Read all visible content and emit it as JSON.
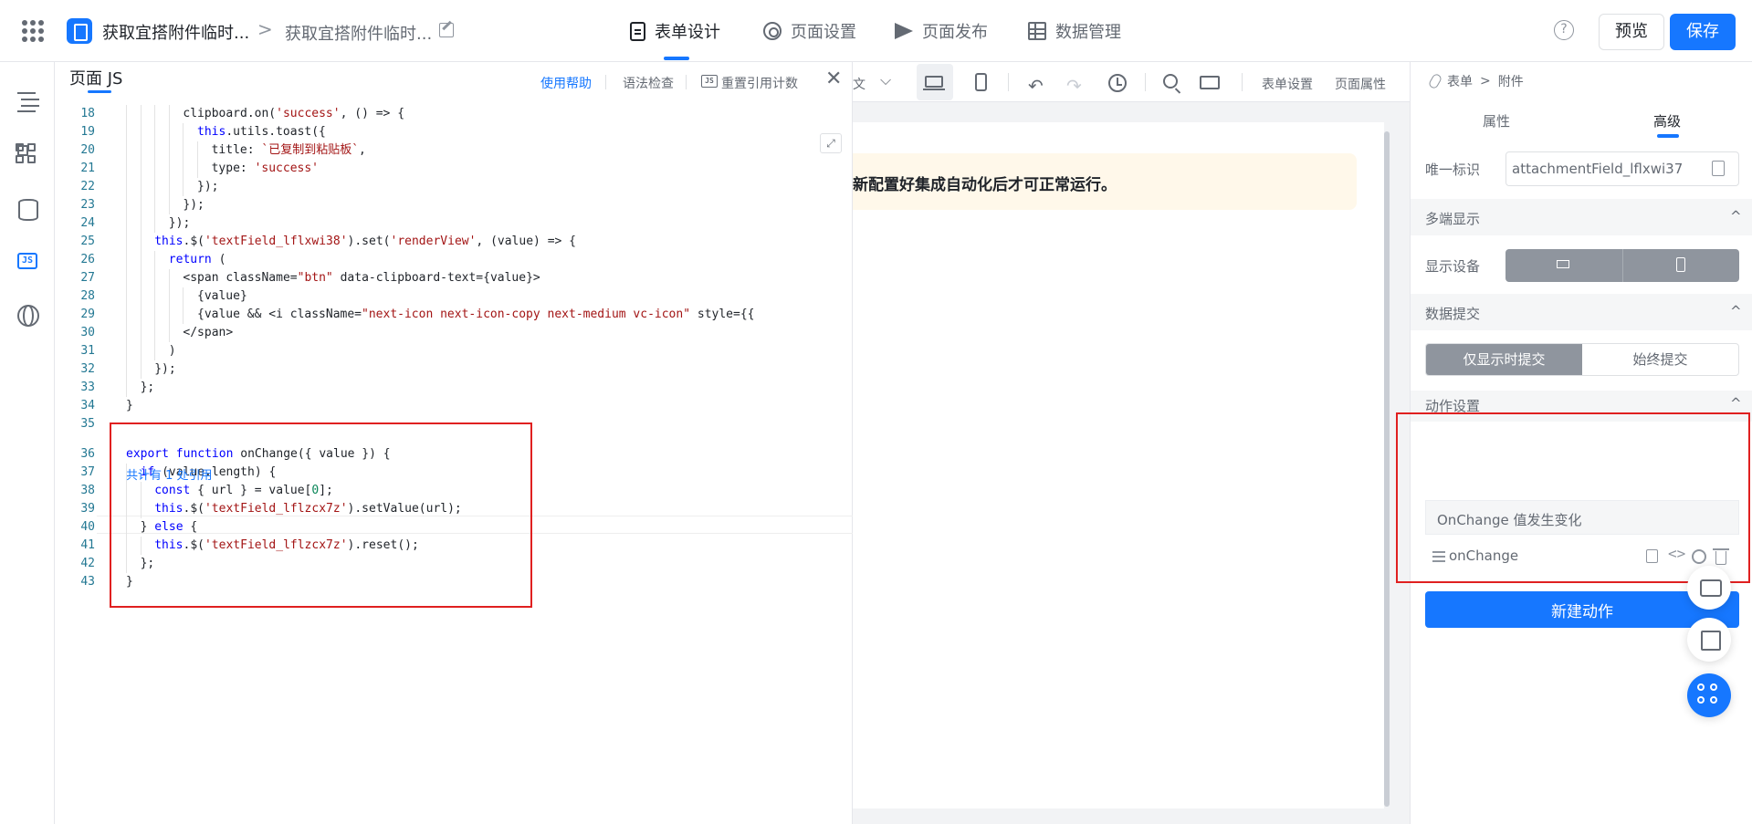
{
  "header": {
    "app_title": "获取宜搭附件临时...",
    "page_title": "获取宜搭附件临时...",
    "crumb_sep": ">",
    "tabs": [
      {
        "label": "表单设计",
        "icon": "form-doc-icon"
      },
      {
        "label": "页面设置",
        "icon": "gear-icon"
      },
      {
        "label": "页面发布",
        "icon": "send-icon"
      },
      {
        "label": "数据管理",
        "icon": "table-icon"
      }
    ],
    "help": "?",
    "preview": "预览",
    "save": "保存"
  },
  "left_rail": [
    "outline-icon",
    "components-icon",
    "datasource-icon",
    "js-icon",
    "globe-icon"
  ],
  "js_panel": {
    "title": "页面 JS",
    "help_link": "使用帮助",
    "lint": "语法检查",
    "reset_refs": "重置引用计数",
    "reset_icon_text": "JS",
    "close": "✕",
    "expand": "⤢",
    "ref_hint": "共计有 1 处引用",
    "lines": [
      {
        "n": "18",
        "indent": 4,
        "parts": [
          [
            "",
            "clipboard.on("
          ],
          [
            "s",
            "'success'"
          ],
          [
            "",
            ", () => {"
          ]
        ]
      },
      {
        "n": "19",
        "indent": 5,
        "parts": [
          [
            "k",
            "this"
          ],
          [
            "",
            ".utils.toast({"
          ]
        ]
      },
      {
        "n": "20",
        "indent": 6,
        "parts": [
          [
            "",
            "title: "
          ],
          [
            "s",
            "`已复制到粘贴板`"
          ],
          [
            "",
            ","
          ]
        ]
      },
      {
        "n": "21",
        "indent": 6,
        "parts": [
          [
            "",
            "type: "
          ],
          [
            "s",
            "'success'"
          ]
        ]
      },
      {
        "n": "22",
        "indent": 5,
        "parts": [
          [
            "",
            "});"
          ]
        ]
      },
      {
        "n": "23",
        "indent": 4,
        "parts": [
          [
            "",
            "});"
          ]
        ]
      },
      {
        "n": "24",
        "indent": 3,
        "parts": [
          [
            "",
            "});"
          ]
        ]
      },
      {
        "n": "25",
        "indent": 2,
        "parts": [
          [
            "k",
            "this"
          ],
          [
            "",
            ".$("
          ],
          [
            "s",
            "'textField_lflxwi38'"
          ],
          [
            "",
            ").set("
          ],
          [
            "s",
            "'renderView'"
          ],
          [
            "",
            ", (value) => {"
          ]
        ]
      },
      {
        "n": "26",
        "indent": 3,
        "parts": [
          [
            "k",
            "return"
          ],
          [
            "",
            " ("
          ]
        ]
      },
      {
        "n": "27",
        "indent": 4,
        "parts": [
          [
            "",
            "<span className="
          ],
          [
            "s",
            "\"btn\""
          ],
          [
            "",
            " data-clipboard-text={value}>"
          ]
        ]
      },
      {
        "n": "28",
        "indent": 5,
        "parts": [
          [
            "",
            "{value}"
          ]
        ]
      },
      {
        "n": "29",
        "indent": 5,
        "parts": [
          [
            "",
            "{value && <i className="
          ],
          [
            "s",
            "\"next-icon next-icon-copy next-medium vc-icon\""
          ],
          [
            "",
            " style={{"
          ]
        ]
      },
      {
        "n": "30",
        "indent": 4,
        "parts": [
          [
            "",
            "</span>"
          ]
        ]
      },
      {
        "n": "31",
        "indent": 3,
        "parts": [
          [
            "",
            ")"
          ]
        ]
      },
      {
        "n": "32",
        "indent": 2,
        "parts": [
          [
            "",
            "});"
          ]
        ]
      },
      {
        "n": "33",
        "indent": 1,
        "parts": [
          [
            "",
            "};"
          ]
        ]
      },
      {
        "n": "34",
        "indent": 0,
        "parts": [
          [
            "",
            "}"
          ]
        ]
      },
      {
        "n": "35",
        "indent": 0,
        "parts": [
          [
            "",
            ""
          ]
        ]
      },
      {
        "n": "36",
        "indent": 0,
        "parts": [
          [
            "k",
            "export"
          ],
          [
            "",
            " "
          ],
          [
            "k",
            "function"
          ],
          [
            "",
            " onChange({ value }) {"
          ]
        ]
      },
      {
        "n": "37",
        "indent": 1,
        "parts": [
          [
            "k",
            "if"
          ],
          [
            "",
            " (value.length) {"
          ]
        ]
      },
      {
        "n": "38",
        "indent": 2,
        "parts": [
          [
            "k",
            "const"
          ],
          [
            "",
            " { url } = value["
          ],
          [
            "n",
            "0"
          ],
          [
            "",
            "];"
          ]
        ]
      },
      {
        "n": "39",
        "indent": 2,
        "parts": [
          [
            "k",
            "this"
          ],
          [
            "",
            ".$("
          ],
          [
            "s",
            "'textField_lflzcx7z'"
          ],
          [
            "",
            ").setValue(url);"
          ]
        ]
      },
      {
        "n": "40",
        "indent": 1,
        "parts": [
          [
            "",
            "} "
          ],
          [
            "k",
            "else"
          ],
          [
            "",
            " {"
          ]
        ]
      },
      {
        "n": "41",
        "indent": 2,
        "parts": [
          [
            "k",
            "this"
          ],
          [
            "",
            ".$("
          ],
          [
            "s",
            "'textField_lflzcx7z'"
          ],
          [
            "",
            ").reset();"
          ]
        ]
      },
      {
        "n": "42",
        "indent": 1,
        "parts": [
          [
            "",
            "};"
          ]
        ]
      },
      {
        "n": "43",
        "indent": 0,
        "parts": [
          [
            "",
            "}"
          ]
        ]
      }
    ]
  },
  "canvas": {
    "toolbar_fragment": "文",
    "chevron": "⌵",
    "undo": "↶",
    "redo": "↷",
    "form_settings": "表单设置",
    "page_props": "页面属性",
    "notice": "新配置好集成自动化后才可正常运行。"
  },
  "right_panel": {
    "crumb": [
      "表单",
      "附件"
    ],
    "crumb_sep": ">",
    "tabs": [
      "属性",
      "高级"
    ],
    "unique_id_label": "唯一标识",
    "unique_id_value": "attachmentField_lflxwi37",
    "sections": {
      "multi_device": "多端显示",
      "data_submit": "数据提交",
      "actions": "动作设置"
    },
    "collapse_glyph": "^",
    "display_device_label": "显示设备",
    "submit_options": [
      "仅显示时提交",
      "始终提交"
    ],
    "action_event": "OnChange 值发生变化",
    "action_name": "onChange",
    "code_glyph": "<>",
    "new_action": "新建动作"
  },
  "colors": {
    "primary": "#1677ff",
    "annotation_red": "#e02020",
    "notice_bg": "#fff8ea"
  }
}
